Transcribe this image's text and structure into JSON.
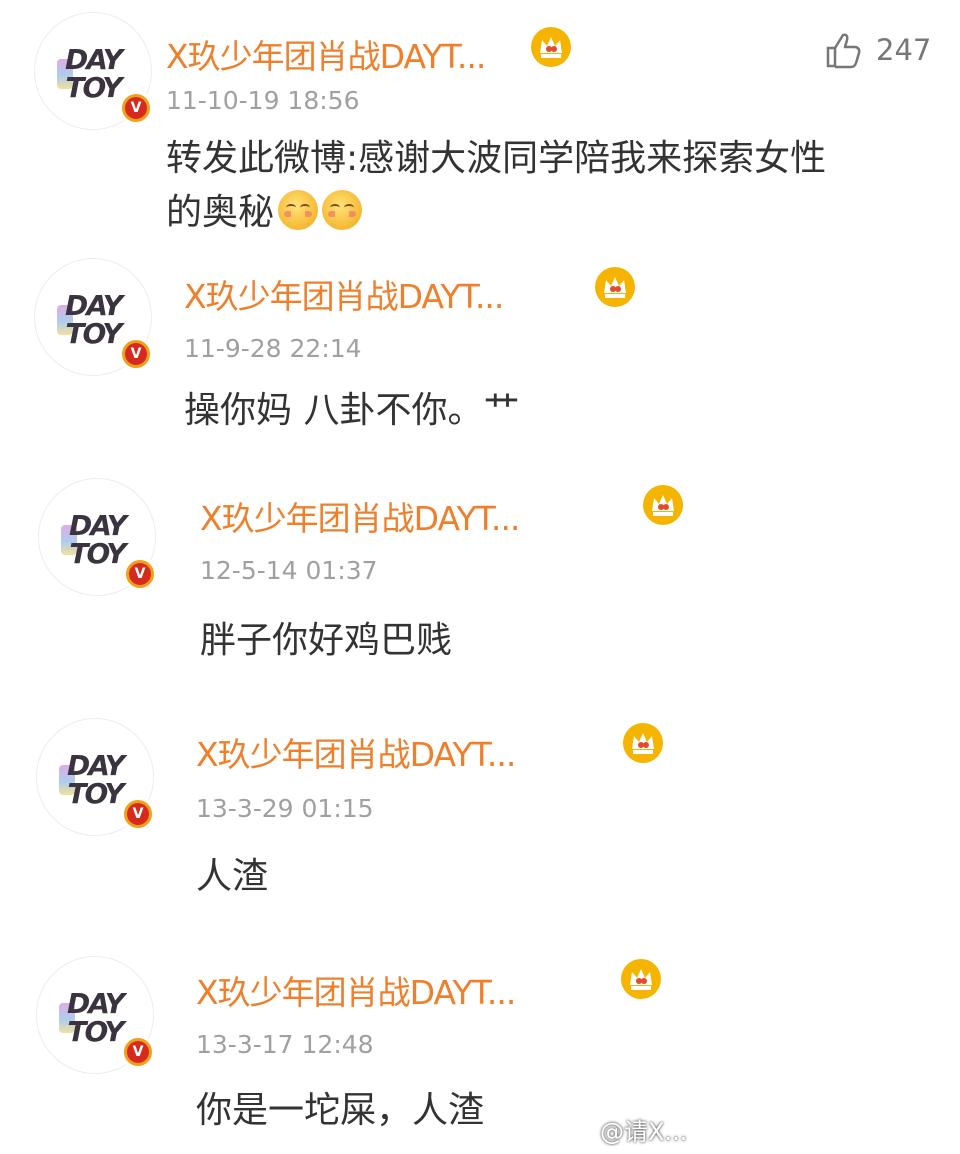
{
  "colors": {
    "username": "#f07f2c",
    "timestamp": "#a0a0a0",
    "text": "#333333",
    "verified_badge": "#d52a1d",
    "crown": "#f4b400"
  },
  "first_like": {
    "icon": "thumbs-up-icon",
    "count": "247"
  },
  "comments": [
    {
      "username": "X玖少年团肖战DAYT...",
      "time": "11-10-19 18:56",
      "lines": [
        "转发此微博:感谢大波同学陪我来探索女性",
        "的奥秘"
      ],
      "emojis": 2
    },
    {
      "username": "X玖少年团肖战DAYT...",
      "time": "11-9-28 22:14",
      "lines": [
        "操你妈  八卦不你。艹"
      ]
    },
    {
      "username": "X玖少年团肖战DAYT...",
      "time": "12-5-14 01:37",
      "lines": [
        "胖子你好鸡巴贱"
      ]
    },
    {
      "username": "X玖少年团肖战DAYT...",
      "time": "13-3-29 01:15",
      "lines": [
        "人渣"
      ]
    },
    {
      "username": "X玖少年团肖战DAYT...",
      "time": "13-3-17 12:48",
      "lines": [
        "你是一坨屎，人渣"
      ]
    }
  ],
  "avatar": {
    "logo_top": "DAY",
    "logo_bottom": "TOY",
    "badge": "V"
  },
  "watermark": "@请X..."
}
